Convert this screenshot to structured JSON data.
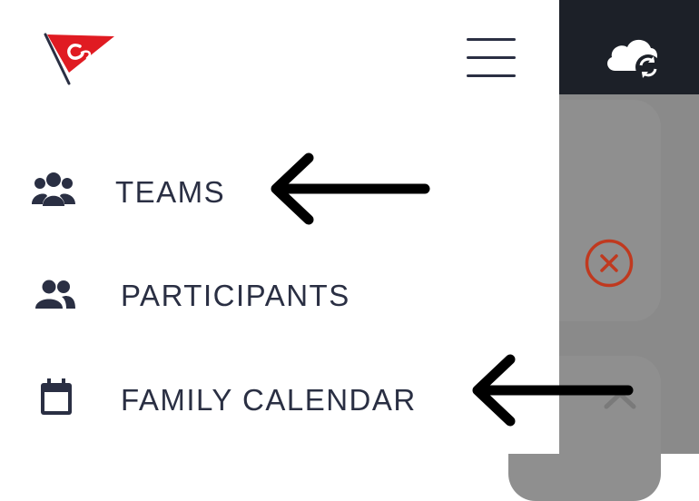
{
  "colors": {
    "background_header": "#1c2028",
    "background_overlay": "#8a8a8a",
    "drawer_background": "#ffffff",
    "menu_text": "#2a2f43",
    "icon_color": "#2a2f43",
    "brand_red": "#e01b22",
    "cancel_red": "#c0391f"
  },
  "drawer": {
    "logo_icon": "club-pennant-logo",
    "menu_toggle_icon": "hamburger-menu-icon",
    "items": [
      {
        "label": "TEAMS",
        "icon": "teams-icon"
      },
      {
        "label": "PARTICIPANTS",
        "icon": "people-icon"
      },
      {
        "label": "FAMILY CALENDAR",
        "icon": "calendar-icon"
      }
    ]
  },
  "background_app": {
    "sync_icon": "cloud-sync-icon",
    "cancel_icon": "cancel-circle-icon",
    "collapse_icon": "chevron-up-icon"
  },
  "annotations": {
    "arrow_icon": "left-arrow-annotation"
  }
}
